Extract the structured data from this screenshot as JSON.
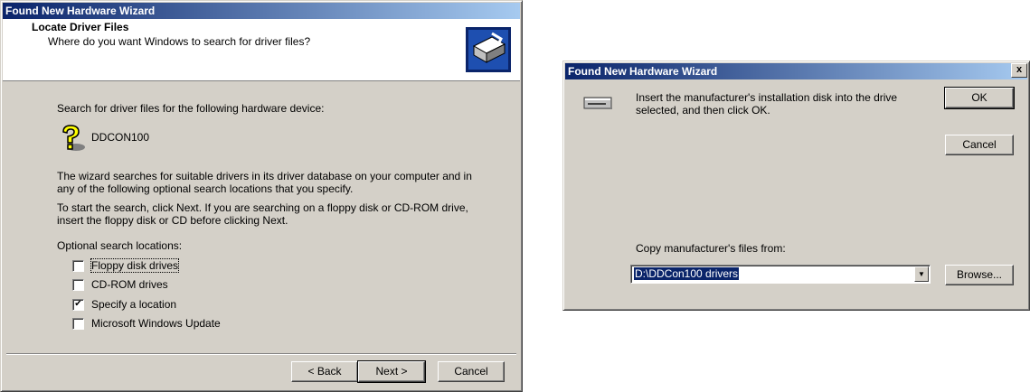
{
  "wizard": {
    "title": "Found New Hardware Wizard",
    "header_title": "Locate Driver Files",
    "header_subtitle": "Where do you want Windows to search for driver files?",
    "intro": "Search for driver files for the following hardware device:",
    "device_name": "DDCON100",
    "para1_line1": "The wizard searches for suitable drivers in its driver database on your computer and in",
    "para1_line2": "any of the following optional search locations that you specify.",
    "para2_line1": "To start the search, click Next. If you are searching on a floppy disk or CD-ROM drive,",
    "para2_line2": "insert the floppy disk or CD before clicking Next.",
    "optional_label": "Optional search locations:",
    "options": [
      {
        "label": "Floppy disk drives",
        "checked": false
      },
      {
        "label": "CD-ROM drives",
        "checked": false
      },
      {
        "label": "Specify a location",
        "checked": true
      },
      {
        "label": "Microsoft Windows Update",
        "checked": false
      }
    ],
    "buttons": {
      "back": "< Back",
      "next": "Next >",
      "cancel": "Cancel"
    }
  },
  "disk_dialog": {
    "title": "Found New Hardware Wizard",
    "close": "x",
    "message_line1": "Insert the manufacturer's installation disk into the drive",
    "message_line2": "selected, and then click OK.",
    "ok": "OK",
    "cancel": "Cancel",
    "copy_label": "Copy manufacturer's files from:",
    "path_value": "D:\\DDCon100 drivers",
    "browse": "Browse..."
  },
  "icons": {
    "wizard": "hardware-install-icon",
    "device": "unknown-device-icon",
    "disk": "disk-drive-icon",
    "dropdown": "chevron-down-icon"
  }
}
